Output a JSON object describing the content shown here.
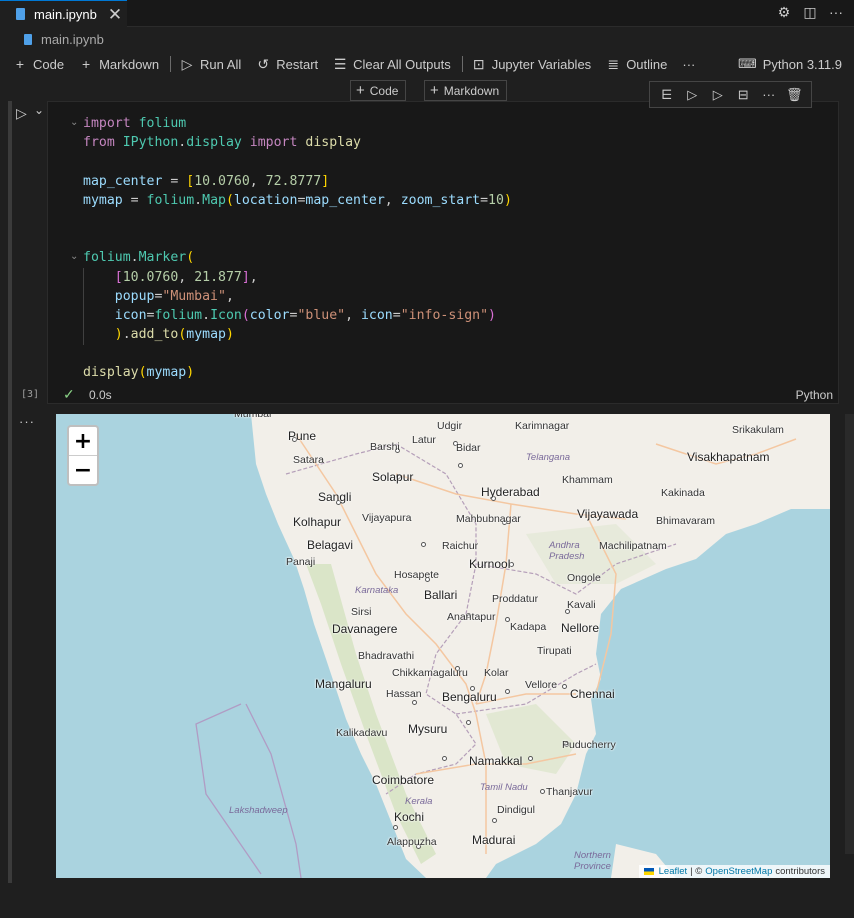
{
  "tab": {
    "filename": "main.ipynb",
    "close_glyph": "✕"
  },
  "tab_actions": {
    "settings": "⚙",
    "split": "◫",
    "more": "···"
  },
  "breadcrumb": {
    "filename": "main.ipynb"
  },
  "toolbar": {
    "code": "Code",
    "markdown": "Markdown",
    "run_all": "Run All",
    "restart": "Restart",
    "clear_all_outputs": "Clear All Outputs",
    "jupyter_variables": "Jupyter Variables",
    "outline": "Outline",
    "more": "···",
    "kernel": "Python 3.11.9"
  },
  "insert": {
    "code": "Code",
    "markdown": "Markdown"
  },
  "cell_toolbar": {
    "more": "···"
  },
  "cell": {
    "execution_count": "[3]",
    "exec_time": "0.0s",
    "language": "Python",
    "code_lines": [
      {
        "tokens": [
          {
            "t": "import",
            "c": "kw"
          },
          {
            "t": " ",
            "c": "pn"
          },
          {
            "t": "folium",
            "c": "mod"
          }
        ]
      },
      {
        "tokens": [
          {
            "t": "from",
            "c": "kw"
          },
          {
            "t": " ",
            "c": "pn"
          },
          {
            "t": "IPython",
            "c": "mod"
          },
          {
            "t": ".",
            "c": "pn"
          },
          {
            "t": "display",
            "c": "mod"
          },
          {
            "t": " ",
            "c": "pn"
          },
          {
            "t": "import",
            "c": "kw"
          },
          {
            "t": " ",
            "c": "pn"
          },
          {
            "t": "display",
            "c": "fn"
          }
        ]
      },
      {
        "tokens": []
      },
      {
        "tokens": [
          {
            "t": "map_center",
            "c": "var"
          },
          {
            "t": " = ",
            "c": "pn"
          },
          {
            "t": "[",
            "c": "br1"
          },
          {
            "t": "10.0760",
            "c": "num"
          },
          {
            "t": ", ",
            "c": "pn"
          },
          {
            "t": "72.8777",
            "c": "num"
          },
          {
            "t": "]",
            "c": "br1"
          }
        ]
      },
      {
        "tokens": [
          {
            "t": "mymap",
            "c": "var"
          },
          {
            "t": " = ",
            "c": "pn"
          },
          {
            "t": "folium",
            "c": "mod"
          },
          {
            "t": ".",
            "c": "pn"
          },
          {
            "t": "Map",
            "c": "mod"
          },
          {
            "t": "(",
            "c": "br1"
          },
          {
            "t": "location",
            "c": "var"
          },
          {
            "t": "=",
            "c": "pn"
          },
          {
            "t": "map_center",
            "c": "var"
          },
          {
            "t": ", ",
            "c": "pn"
          },
          {
            "t": "zoom_start",
            "c": "var"
          },
          {
            "t": "=",
            "c": "pn"
          },
          {
            "t": "10",
            "c": "num"
          },
          {
            "t": ")",
            "c": "br1"
          }
        ]
      },
      {
        "tokens": []
      },
      {
        "tokens": []
      },
      {
        "tokens": [
          {
            "t": "folium",
            "c": "mod"
          },
          {
            "t": ".",
            "c": "pn"
          },
          {
            "t": "Marker",
            "c": "mod"
          },
          {
            "t": "(",
            "c": "br1"
          }
        ]
      },
      {
        "tokens": [
          {
            "t": "    ",
            "c": "pn"
          },
          {
            "t": "[",
            "c": "br2"
          },
          {
            "t": "10.0760",
            "c": "num"
          },
          {
            "t": ", ",
            "c": "pn"
          },
          {
            "t": "21.877",
            "c": "num"
          },
          {
            "t": "]",
            "c": "br2"
          },
          {
            "t": ",",
            "c": "pn"
          }
        ]
      },
      {
        "tokens": [
          {
            "t": "    ",
            "c": "pn"
          },
          {
            "t": "popup",
            "c": "var"
          },
          {
            "t": "=",
            "c": "pn"
          },
          {
            "t": "\"Mumbai\"",
            "c": "str"
          },
          {
            "t": ",",
            "c": "pn"
          }
        ]
      },
      {
        "tokens": [
          {
            "t": "    ",
            "c": "pn"
          },
          {
            "t": "icon",
            "c": "var"
          },
          {
            "t": "=",
            "c": "pn"
          },
          {
            "t": "folium",
            "c": "mod"
          },
          {
            "t": ".",
            "c": "pn"
          },
          {
            "t": "Icon",
            "c": "mod"
          },
          {
            "t": "(",
            "c": "br2"
          },
          {
            "t": "color",
            "c": "var"
          },
          {
            "t": "=",
            "c": "pn"
          },
          {
            "t": "\"blue\"",
            "c": "str"
          },
          {
            "t": ", ",
            "c": "pn"
          },
          {
            "t": "icon",
            "c": "var"
          },
          {
            "t": "=",
            "c": "pn"
          },
          {
            "t": "\"info-sign\"",
            "c": "str"
          },
          {
            "t": ")",
            "c": "br2"
          }
        ]
      },
      {
        "tokens": [
          {
            "t": "    ",
            "c": "pn"
          },
          {
            "t": ")",
            "c": "br1"
          },
          {
            "t": ".",
            "c": "pn"
          },
          {
            "t": "add_to",
            "c": "fn"
          },
          {
            "t": "(",
            "c": "br1"
          },
          {
            "t": "mymap",
            "c": "var"
          },
          {
            "t": ")",
            "c": "br1"
          }
        ]
      },
      {
        "tokens": []
      },
      {
        "tokens": [
          {
            "t": "display",
            "c": "fn"
          },
          {
            "t": "(",
            "c": "br1"
          },
          {
            "t": "mymap",
            "c": "var"
          },
          {
            "t": ")",
            "c": "br1"
          }
        ]
      }
    ]
  },
  "output": {
    "more": "···"
  },
  "map": {
    "zoom_in": "+",
    "zoom_out": "−",
    "attribution": {
      "leaflet": "Leaflet",
      "sep": " | © ",
      "osm": "OpenStreetMap",
      "suffix": "contributors"
    },
    "labels": [
      {
        "name": "Mumbai",
        "kind": "city"
      },
      {
        "name": "Pune",
        "kind": "big"
      },
      {
        "name": "Satara",
        "kind": "city"
      },
      {
        "name": "Barshi",
        "kind": "city"
      },
      {
        "name": "Latur",
        "kind": "city"
      },
      {
        "name": "Udgir",
        "kind": "city"
      },
      {
        "name": "Karimnagar",
        "kind": "city"
      },
      {
        "name": "Srikakulam",
        "kind": "city"
      },
      {
        "name": "Bidar",
        "kind": "city"
      },
      {
        "name": "Telangana",
        "kind": "state"
      },
      {
        "name": "Visakhapatnam",
        "kind": "big"
      },
      {
        "name": "Solapur",
        "kind": "big"
      },
      {
        "name": "Khammam",
        "kind": "city"
      },
      {
        "name": "Hyderabad",
        "kind": "big"
      },
      {
        "name": "Sangli",
        "kind": "big"
      },
      {
        "name": "Kakinada",
        "kind": "city"
      },
      {
        "name": "Kolhapur",
        "kind": "big"
      },
      {
        "name": "Vijayapura",
        "kind": "city"
      },
      {
        "name": "Mahbubnagar",
        "kind": "city"
      },
      {
        "name": "Vijayawada",
        "kind": "big"
      },
      {
        "name": "Bhimavaram",
        "kind": "city"
      },
      {
        "name": "Belagavi",
        "kind": "big"
      },
      {
        "name": "Raichur",
        "kind": "city"
      },
      {
        "name": "Andhra",
        "kind": "state"
      },
      {
        "name": "Pradesh",
        "kind": "state"
      },
      {
        "name": "Machilipatnam",
        "kind": "city"
      },
      {
        "name": "Panaji",
        "kind": "city"
      },
      {
        "name": "Kurnool",
        "kind": "big"
      },
      {
        "name": "Hosapete",
        "kind": "city"
      },
      {
        "name": "Ongole",
        "kind": "city"
      },
      {
        "name": "Karnataka",
        "kind": "state"
      },
      {
        "name": "Ballari",
        "kind": "big"
      },
      {
        "name": "Proddatur",
        "kind": "city"
      },
      {
        "name": "Sirsi",
        "kind": "city"
      },
      {
        "name": "Kavali",
        "kind": "city"
      },
      {
        "name": "Anantapur",
        "kind": "city"
      },
      {
        "name": "Davanagere",
        "kind": "big"
      },
      {
        "name": "Kadapa",
        "kind": "city"
      },
      {
        "name": "Nellore",
        "kind": "big"
      },
      {
        "name": "Tirupati",
        "kind": "city"
      },
      {
        "name": "Bhadravathi",
        "kind": "city"
      },
      {
        "name": "Chikkamagaluru",
        "kind": "city"
      },
      {
        "name": "Kolar",
        "kind": "city"
      },
      {
        "name": "Mangaluru",
        "kind": "big"
      },
      {
        "name": "Vellore",
        "kind": "city"
      },
      {
        "name": "Chennai",
        "kind": "big"
      },
      {
        "name": "Hassan",
        "kind": "city"
      },
      {
        "name": "Bengaluru",
        "kind": "big"
      },
      {
        "name": "Kalikadavu",
        "kind": "city"
      },
      {
        "name": "Mysuru",
        "kind": "big"
      },
      {
        "name": "Puducherry",
        "kind": "city"
      },
      {
        "name": "Namakkal",
        "kind": "big"
      },
      {
        "name": "Coimbatore",
        "kind": "big"
      },
      {
        "name": "Tamil Nadu",
        "kind": "state"
      },
      {
        "name": "Thanjavur",
        "kind": "city"
      },
      {
        "name": "Kerala",
        "kind": "state"
      },
      {
        "name": "Lakshadweep",
        "kind": "state"
      },
      {
        "name": "Dindigul",
        "kind": "city"
      },
      {
        "name": "Kochi",
        "kind": "big"
      },
      {
        "name": "Madurai",
        "kind": "big"
      },
      {
        "name": "Alappuzha",
        "kind": "city"
      },
      {
        "name": "Northern",
        "kind": "state"
      },
      {
        "name": "Province",
        "kind": "state"
      }
    ]
  }
}
